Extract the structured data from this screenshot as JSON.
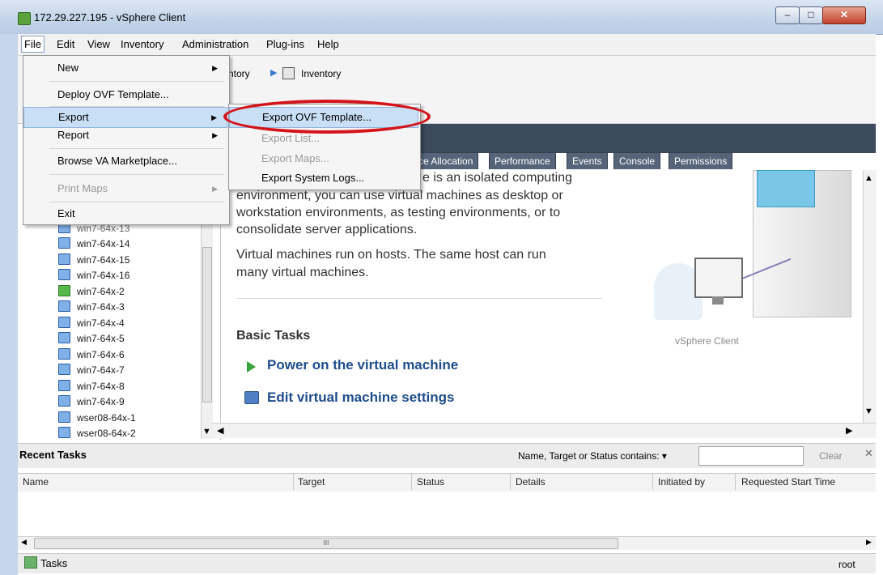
{
  "window": {
    "title": "172.29.227.195 - vSphere Client",
    "minimize": "–",
    "maximize": "□",
    "close": "✕"
  },
  "menubar": [
    "File",
    "Edit",
    "View",
    "Inventory",
    "Administration",
    "Plug-ins",
    "Help"
  ],
  "breadcrumb": {
    "partial": "ntory",
    "current": "Inventory"
  },
  "file_menu": {
    "items": [
      {
        "label": "New",
        "has_submenu": true
      },
      {
        "label": "Deploy OVF Template...",
        "has_submenu": false
      },
      {
        "label": "Export",
        "has_submenu": true,
        "highlighted": true
      },
      {
        "label": "Report",
        "has_submenu": true
      },
      {
        "label": "Browse VA Marketplace...",
        "has_submenu": false
      },
      {
        "label": "Print Maps",
        "has_submenu": true,
        "disabled": true
      },
      {
        "label": "Exit",
        "has_submenu": false
      }
    ]
  },
  "export_menu": {
    "items": [
      {
        "label": "Export OVF Template...",
        "highlighted": true
      },
      {
        "label": "Export List...",
        "disabled": true
      },
      {
        "label": "Export Maps...",
        "disabled": true
      },
      {
        "label": "Export System Logs...",
        "disabled": false
      }
    ]
  },
  "tabs": [
    "ce Allocation",
    "Performance",
    "Events",
    "Console",
    "Permissions"
  ],
  "tree": {
    "partial_top": "win7-64x-13",
    "items": [
      "win7-64x-14",
      "win7-64x-15",
      "win7-64x-16",
      "win7-64x-2",
      "win7-64x-3",
      "win7-64x-4",
      "win7-64x-5",
      "win7-64x-6",
      "win7-64x-7",
      "win7-64x-8",
      "win7-64x-9",
      "wser08-64x-1",
      "wser08-64x-2"
    ]
  },
  "content": {
    "line1": "e is an isolated computing",
    "line2": "environment, you can use virtual machines as desktop or",
    "line3": "workstation environments, as testing environments, or to",
    "line4": "consolidate server applications.",
    "line5": "Virtual machines run on hosts. The same host can run",
    "line6": "many virtual machines.",
    "basic_tasks": "Basic Tasks",
    "task1": "Power on the virtual machine",
    "task2": "Edit virtual machine settings",
    "illustration_label": "vSphere Client"
  },
  "recent_tasks": {
    "title": "Recent Tasks",
    "filter_label": "Name, Target or Status contains: ▾",
    "filter_value": "",
    "clear": "Clear",
    "close": "✕",
    "columns": [
      "Name",
      "Target",
      "Status",
      "Details",
      "Initiated by",
      "Requested Start Time"
    ],
    "scroll_grip": "III"
  },
  "statusbar": {
    "tasks": "Tasks",
    "user": "root"
  },
  "colors": {
    "accent_highlight": "#c9dff5",
    "annotation_red": "#d4141a",
    "link": "#1f4e8c",
    "header_dark": "#3c4a5e"
  }
}
